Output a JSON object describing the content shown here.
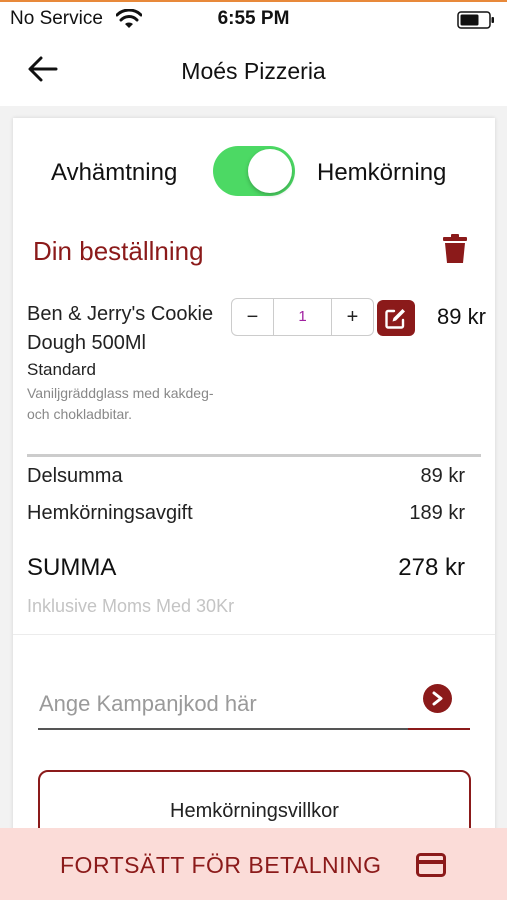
{
  "status_bar": {
    "carrier": "No Service",
    "time": "6:55 PM"
  },
  "nav": {
    "title": "Moés Pizzeria",
    "back_icon": "back-arrow-icon"
  },
  "delivery_toggle": {
    "left_label": "Avhämtning",
    "right_label": "Hemkörning",
    "on": true,
    "on_color": "#4cd964"
  },
  "order": {
    "title": "Din beställning",
    "items": [
      {
        "name": "Ben & Jerry's Cookie Dough 500Ml",
        "variant": "Standard",
        "description": "Vaniljgräddglass med kakdeg- och chokladbitar.",
        "quantity": "1",
        "minus_label": "−",
        "plus_label": "+",
        "price": "89 kr"
      }
    ]
  },
  "summary": {
    "subtotal_label": "Delsumma",
    "subtotal_value": "89 kr",
    "fee_label": "Hemkörningsavgift",
    "fee_value": "189 kr",
    "total_label": "SUMMA",
    "total_value": "278 kr",
    "vat_note": "Inklusive Moms Med 30Kr"
  },
  "promo": {
    "placeholder": "Ange Kampanjkod här"
  },
  "terms_button": "Hemkörningsvillkor",
  "checkout": {
    "label": "FORTSÄTT FÖR BETALNING"
  },
  "colors": {
    "brand": "#8b1a1a",
    "checkout_bg": "#fbdcd8",
    "toggle_on": "#4cd964"
  }
}
